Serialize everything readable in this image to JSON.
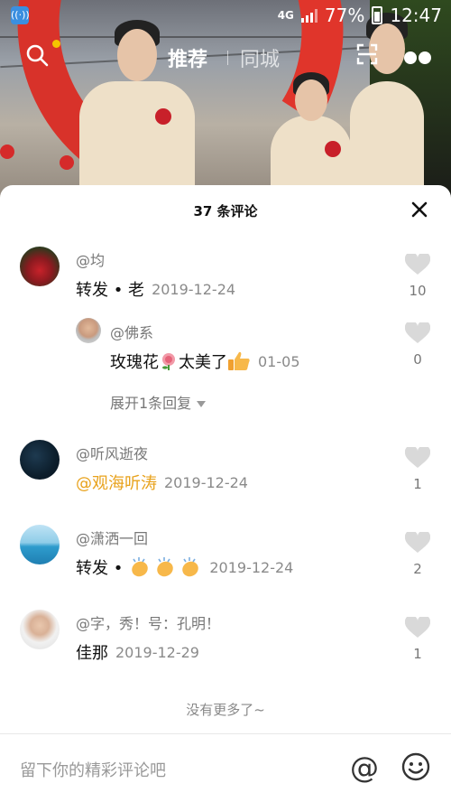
{
  "status_bar": {
    "network": "4G",
    "battery": "77%",
    "time": "12:47"
  },
  "nav": {
    "tab_recommend": "推荐",
    "tab_local": "同城"
  },
  "sheet": {
    "title": "37 条评论",
    "comments": [
      {
        "user": "@均",
        "text": "转发 • 老",
        "date": "2019-12-24",
        "likes": "10"
      },
      {
        "user": "@佛系",
        "text_a": "玫瑰花",
        "text_b": "太美了",
        "date": "01-05",
        "likes": "0"
      },
      {
        "user": "@听风逝夜",
        "mention": "@观海听涛",
        "date": "2019-12-24",
        "likes": "1"
      },
      {
        "user": "@潇洒一回",
        "text": "转发 •",
        "date": "2019-12-24",
        "likes": "2"
      },
      {
        "user": "@字，秀！号：孔明！",
        "text": "佳那",
        "date": "2019-12-29",
        "likes": "1"
      }
    ],
    "expand_replies": "展开1条回复",
    "no_more": "没有更多了~"
  },
  "footer": {
    "placeholder": "留下你的精彩评论吧"
  },
  "colors": {
    "mention": "#e8a21c",
    "status_app": "#3a8fe0",
    "dot": "#f5c400"
  }
}
